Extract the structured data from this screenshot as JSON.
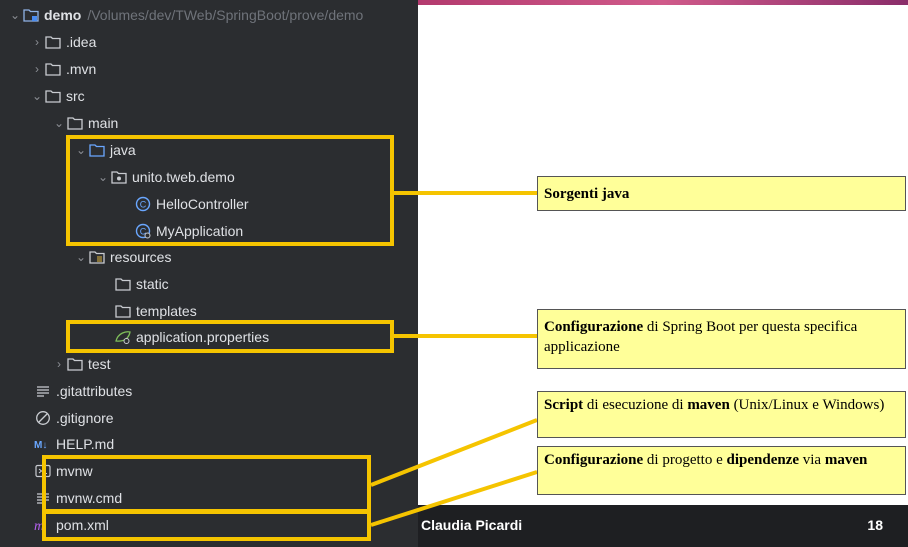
{
  "tree": {
    "root": {
      "name": "demo",
      "path": "/Volumes/dev/TWeb/SpringBoot/prove/demo"
    },
    "items": [
      {
        "label": ".idea"
      },
      {
        "label": ".mvn"
      },
      {
        "label": "src"
      },
      {
        "label": "main"
      },
      {
        "label": "java"
      },
      {
        "label": "unito.tweb.demo"
      },
      {
        "label": "HelloController"
      },
      {
        "label": "MyApplication"
      },
      {
        "label": "resources"
      },
      {
        "label": "static"
      },
      {
        "label": "templates"
      },
      {
        "label": "application.properties"
      },
      {
        "label": "test"
      },
      {
        "label": ".gitattributes"
      },
      {
        "label": ".gitignore"
      },
      {
        "label": "HELP.md"
      },
      {
        "label": "mvnw"
      },
      {
        "label": "mvnw.cmd"
      },
      {
        "label": "pom.xml"
      }
    ]
  },
  "callouts": {
    "java": {
      "bold": "Sorgenti java"
    },
    "config": {
      "bold": "Configurazione",
      "rest": " di Spring Boot per questa specifica applicazione"
    },
    "script": {
      "bold1": "Script",
      "mid": " di esecuzione di ",
      "bold2": "maven",
      "rest": " (Unix/Linux e Windows)"
    },
    "pom": {
      "bold1": "Configurazione",
      "mid1": " di progetto e ",
      "bold2": "dipendenze",
      "mid2": " via ",
      "bold3": "maven"
    }
  },
  "footer": {
    "author": "Claudia Picardi",
    "page": "18"
  },
  "colors": {
    "highlight": "#f5c400",
    "callout_bg": "#ffff99",
    "tree_bg": "#2b2d30"
  }
}
